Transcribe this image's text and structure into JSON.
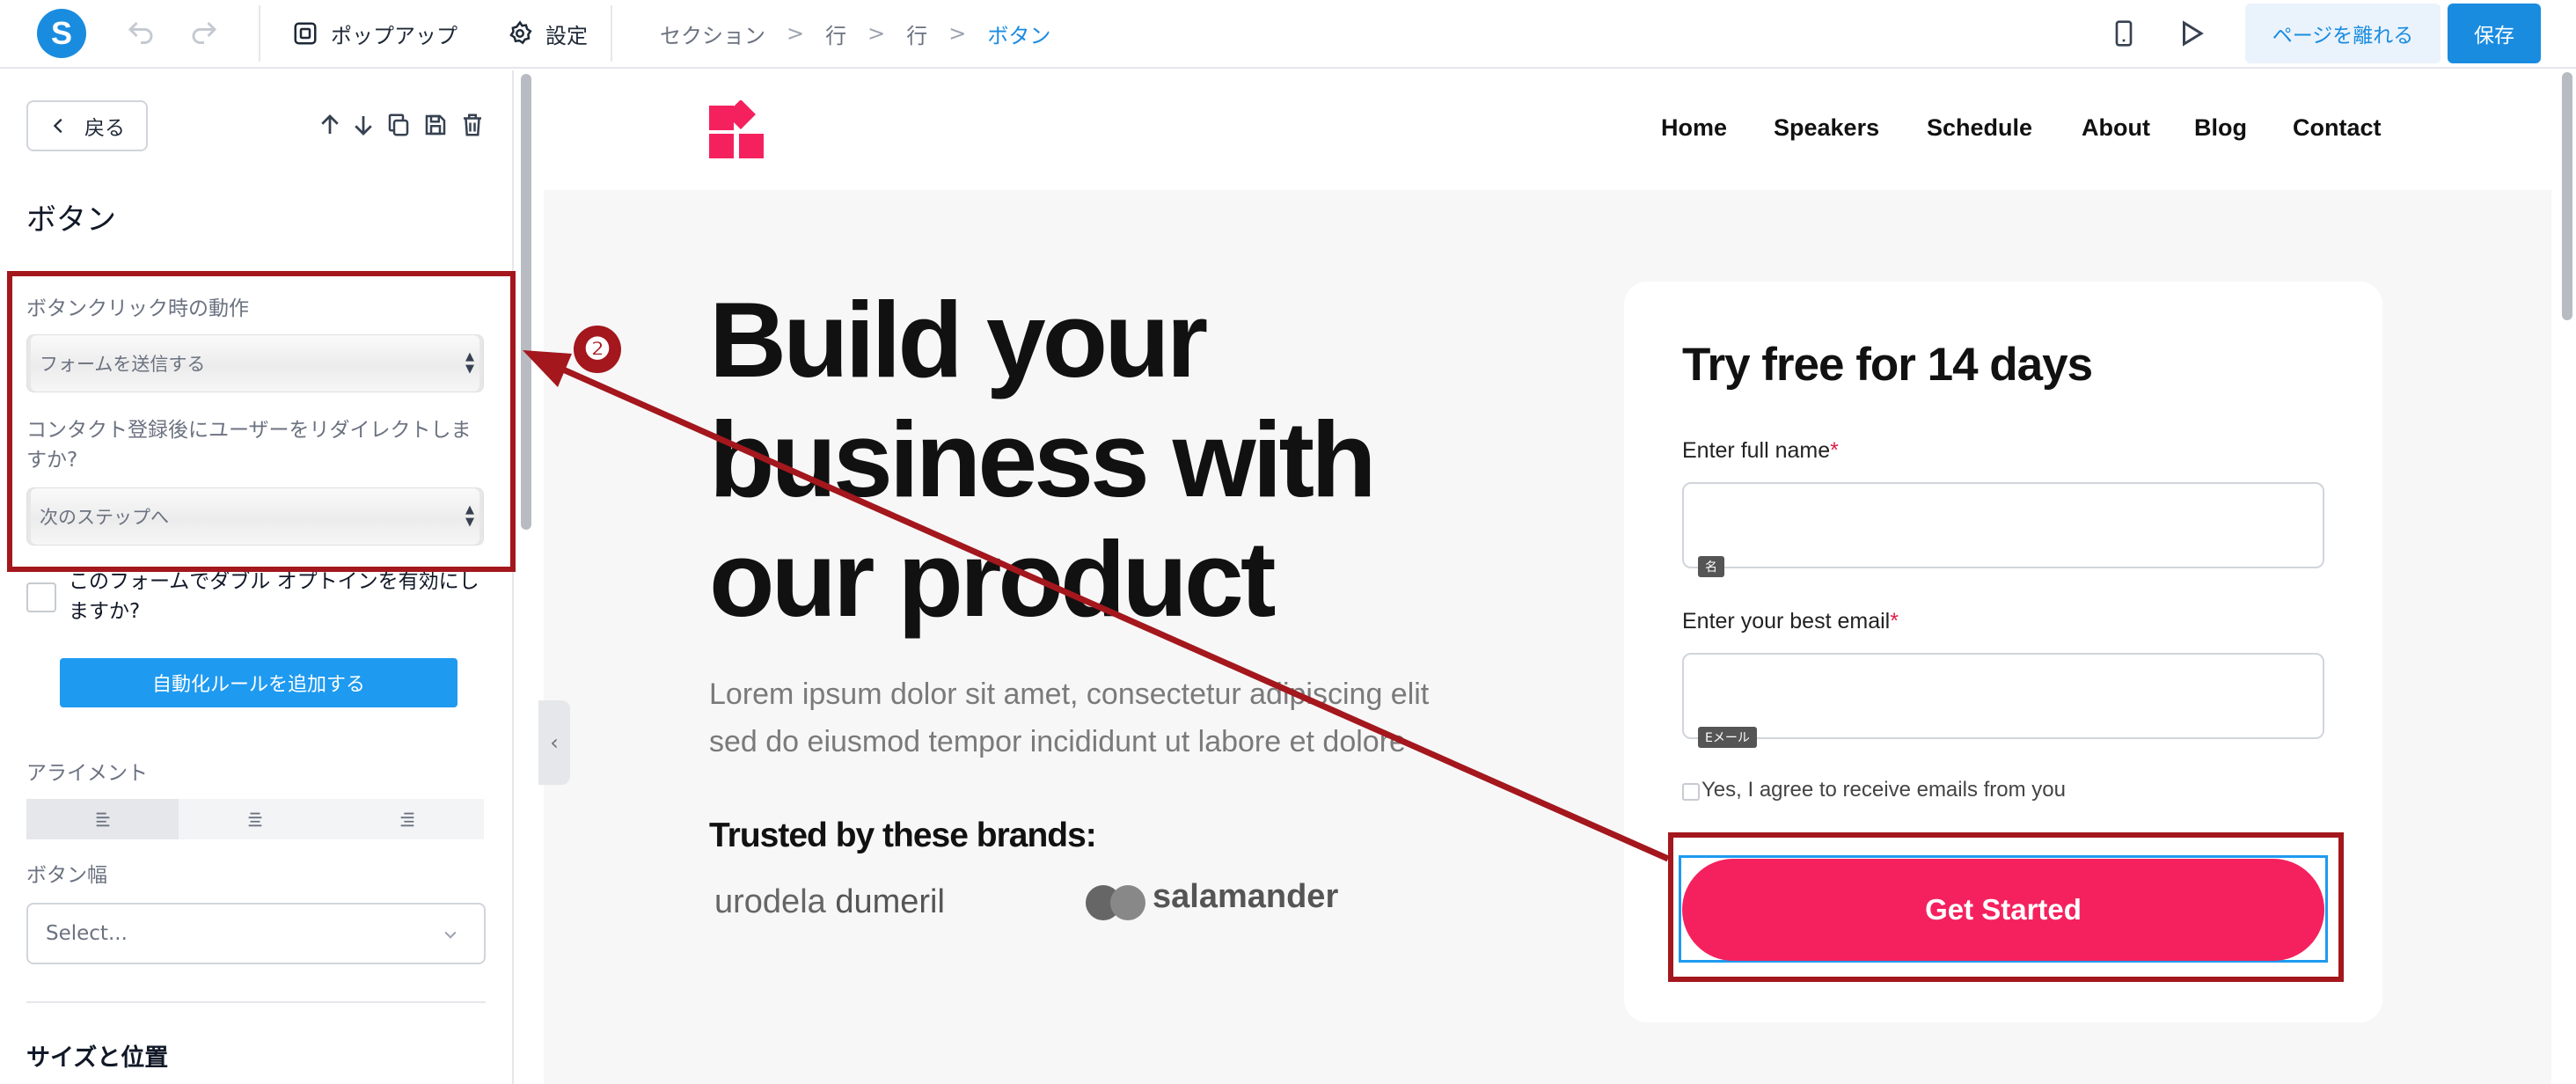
{
  "topbar": {
    "logo_letter": "S",
    "popup_label": "ポップアップ",
    "settings_label": "設定",
    "breadcrumb": [
      "セクション",
      "行",
      "行",
      "ボタン"
    ],
    "leave_label": "ページを離れる",
    "save_label": "保存"
  },
  "panel": {
    "back_label": "戻る",
    "title": "ボタン",
    "action_label": "ボタンクリック時の動作",
    "action_value": "フォームを送信する",
    "redirect_label": "コンタクト登録後にユーザーをリダイレクトしますか?",
    "redirect_value": "次のステップへ",
    "double_optin_label": "このフォームでダブル オプトインを有効にしますか?",
    "automation_button": "自動化ルールを追加する",
    "alignment_label": "アライメント",
    "button_width_label": "ボタン幅",
    "button_width_placeholder": "Select...",
    "size_position_label": "サイズと位置"
  },
  "site": {
    "nav": [
      "Home",
      "Speakers",
      "Schedule",
      "About",
      "Blog",
      "Contact"
    ],
    "hero_title_lines": [
      "Build your",
      "business with",
      "our product"
    ],
    "hero_sub_lines": [
      "Lorem ipsum dolor sit amet, consectetur adipiscing elit",
      "sed do eiusmod tempor incididunt ut labore et dolore"
    ],
    "trusted": "Trusted by these brands:",
    "brand1_a": "urodela",
    "brand1_b": "dumeril",
    "brand2": "salamander",
    "brand_color": "#f5215e"
  },
  "form": {
    "title": "Try free for 14 days",
    "name_label": "Enter full name",
    "name_tag": "名",
    "email_label": "Enter your best email",
    "email_tag": "Eメール",
    "required_mark": "*",
    "agree_text": "Yes, I agree to receive emails from you",
    "cta": "Get Started"
  },
  "annotation": {
    "number": "❷",
    "color": "#a3171d"
  }
}
